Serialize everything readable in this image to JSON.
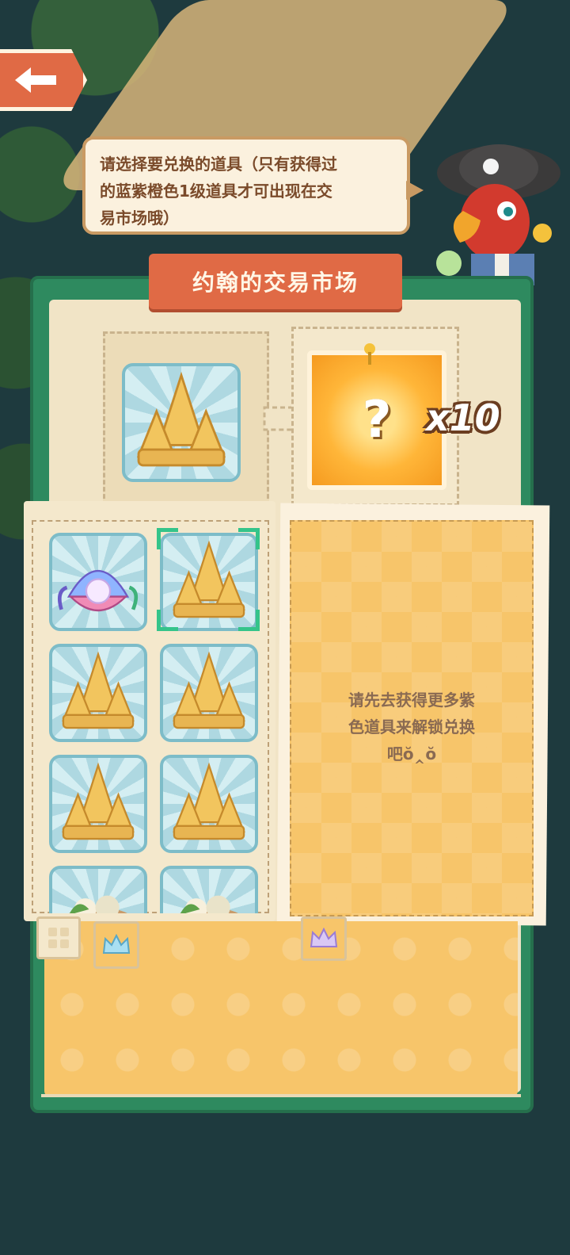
{
  "hint": {
    "line1": "请选择要兑换的道具（只有获得过",
    "line2": "的蓝紫橙色1级道具才可出现在交",
    "line3": "易市场哦）"
  },
  "market": {
    "title": "约翰的交易市场",
    "multiplier": "x10",
    "mystery_symbol": "?"
  },
  "grid_items": [
    {
      "kind": "pearl-shell"
    },
    {
      "kind": "sand-castle",
      "selected": true
    },
    {
      "kind": "sand-castle"
    },
    {
      "kind": "sand-castle"
    },
    {
      "kind": "sand-castle"
    },
    {
      "kind": "sand-castle"
    },
    {
      "kind": "food-platter"
    },
    {
      "kind": "food-platter"
    }
  ],
  "locked_panel": {
    "line1": "请先去获得更多紫",
    "line2": "色道具来解锁兑换",
    "line3": "吧ŏ‸ŏ"
  },
  "tabs": [
    {
      "icon": "grid-icon"
    },
    {
      "icon": "blue-crown-icon"
    },
    {
      "icon": "purple-crown-icon"
    }
  ],
  "colors": {
    "accent": "#e06a45",
    "book_green": "#2e8a5f",
    "selected": "#34c48a"
  }
}
